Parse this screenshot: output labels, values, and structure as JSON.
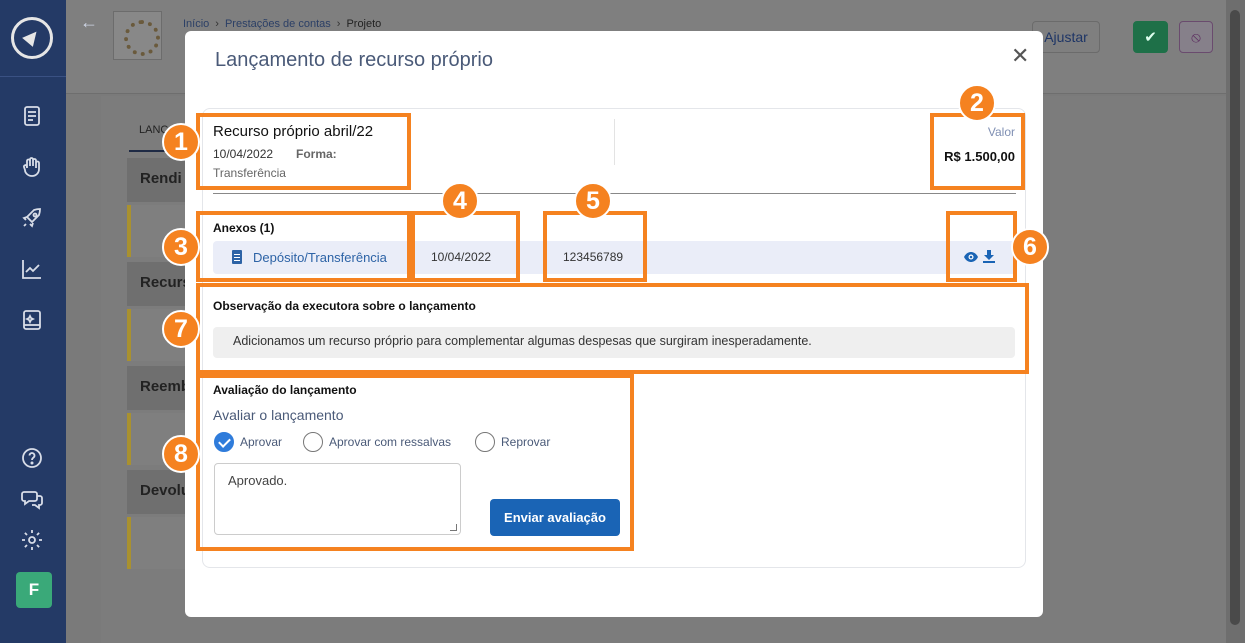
{
  "sidebar": {
    "avatar_letter": "F",
    "icons": [
      "document-icon",
      "hand-heart-icon",
      "rocket-icon",
      "chart-line-icon",
      "book-sparkle-icon",
      "help-icon",
      "chat-icon",
      "gear-icon"
    ]
  },
  "background": {
    "breadcrumb": [
      "Início",
      "Prestações de contas",
      "Projeto"
    ],
    "ajustar_label": "Ajustar",
    "tab_label": "LANÇ",
    "sections": [
      "Rendi",
      "Recurs",
      "Reemb",
      "Devolu"
    ]
  },
  "modal": {
    "title": "Lançamento de recurso próprio",
    "record": {
      "title": "Recurso próprio abril/22",
      "date": "10/04/2022",
      "forma_label": "Forma:",
      "forma_value": "Transferência",
      "valor_label": "Valor",
      "valor_value": "R$ 1.500,00"
    },
    "anexos": {
      "title": "Anexos (1)",
      "items": [
        {
          "name": "Depósito/Transferência",
          "date": "10/04/2022",
          "number": "123456789"
        }
      ]
    },
    "observacao": {
      "title": "Observação da executora sobre o lançamento",
      "text": "Adicionamos um recurso próprio para complementar algumas despesas que surgiram inesperadamente."
    },
    "avaliacao": {
      "title": "Avaliação do lançamento",
      "subtitle": "Avaliar o lançamento",
      "options": [
        "Aprovar",
        "Aprovar com ressalvas",
        "Reprovar"
      ],
      "selected": "Aprovar",
      "comment": "Aprovado.",
      "submit_label": "Enviar avaliação"
    }
  },
  "annotations": {
    "color": "#f58220",
    "labels": [
      "1",
      "2",
      "3",
      "4",
      "5",
      "6",
      "7",
      "8"
    ]
  }
}
